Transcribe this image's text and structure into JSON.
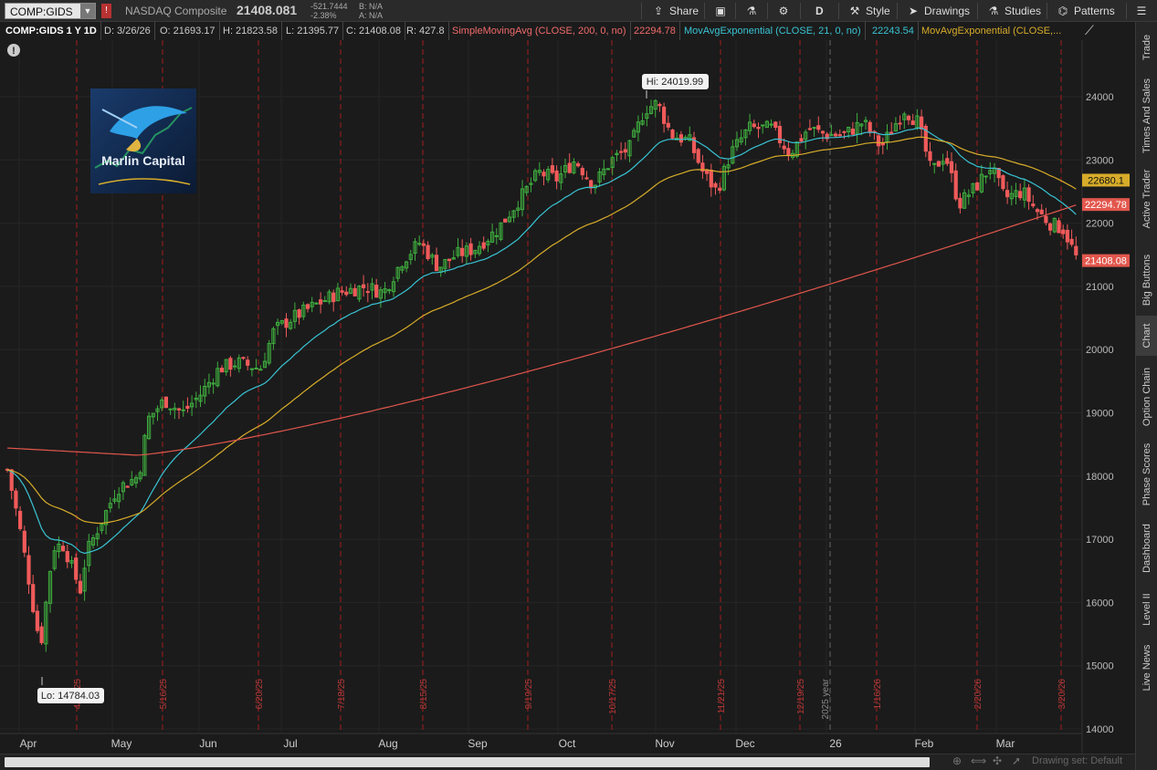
{
  "toolbar": {
    "symbol": "COMP:GIDS",
    "company": "NASDAQ Composite",
    "last": "21408.081",
    "change": "-521.7444",
    "change_pct": "-2.38%",
    "bid": "B: N/A",
    "ask": "A: N/A",
    "share": "Share",
    "period_flag": "D",
    "style": "Style",
    "drawings": "Drawings",
    "studies": "Studies",
    "patterns": "Patterns"
  },
  "info": {
    "title": "COMP:GIDS 1 Y 1D",
    "date": "D: 3/26/26",
    "open": "O: 21693.17",
    "high": "H: 21823.58",
    "low": "L: 21395.77",
    "close": "C: 21408.08",
    "range": "R: 427.8",
    "sma_label": "SimpleMovingAvg (CLOSE, 200, 0, no)",
    "sma_value": "22294.78",
    "ema21_label": "MovAvgExponential (CLOSE, 21, 0, no)",
    "ema21_value": "22243.54",
    "ema50_label": "MovAvgExponential (CLOSE,..."
  },
  "chart": {
    "logo_text": "Marlin Capital",
    "hi_label": "Hi: 24019.99",
    "lo_label": "Lo: 14784.03",
    "price_ticks": [
      "24000",
      "23000",
      "22000",
      "21000",
      "20000",
      "19000",
      "18000",
      "17000",
      "16000",
      "15000",
      "14000"
    ],
    "month_labels": [
      "Apr",
      "May",
      "Jun",
      "Jul",
      "Aug",
      "Sep",
      "Oct",
      "Nov",
      "Dec",
      "26",
      "Feb",
      "Mar"
    ],
    "event_labels": [
      "4/17/25",
      "5/16/25",
      "6/20/25",
      "7/18/25",
      "8/15/25",
      "9/19/25",
      "10/17/25",
      "11/21/25",
      "12/19/25",
      "1/16/26",
      "2/20/26",
      "3/20/26"
    ],
    "year_label": "2025 year",
    "price_badges": {
      "ema50": "22680.1",
      "sma200": "22294.78",
      "last": "21408.08"
    },
    "colors": {
      "up": "#3fae3f",
      "down": "#f05a5a",
      "ema21": "#39c3d3",
      "ema50": "#d7ac2a",
      "sma200": "#e2574d",
      "expiry": "#a31c1c"
    }
  },
  "sidebar": [
    "Trade",
    "Times And Sales",
    "Active Trader",
    "Big Buttons",
    "Chart",
    "Option Chain",
    "Phase Scores",
    "Dashboard",
    "Level II",
    "Live News"
  ],
  "bottom": {
    "drawing_set": "Drawing set: Default"
  }
}
